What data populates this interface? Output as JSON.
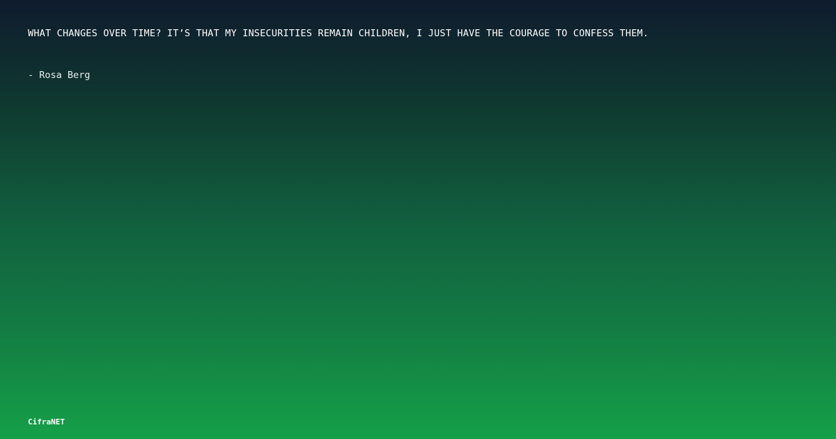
{
  "quote": {
    "text": "WHAT CHANGES OVER TIME? IT’S THAT MY INSECURITIES REMAIN CHILDREN, I JUST HAVE THE COURAGE TO CONFESS THEM.",
    "author": "- Rosa Berg"
  },
  "brand": {
    "name": "CifraNET"
  },
  "colors": {
    "gradient_top": "#0f1b2e",
    "gradient_bottom": "#15a048",
    "text": "#ffffff"
  }
}
